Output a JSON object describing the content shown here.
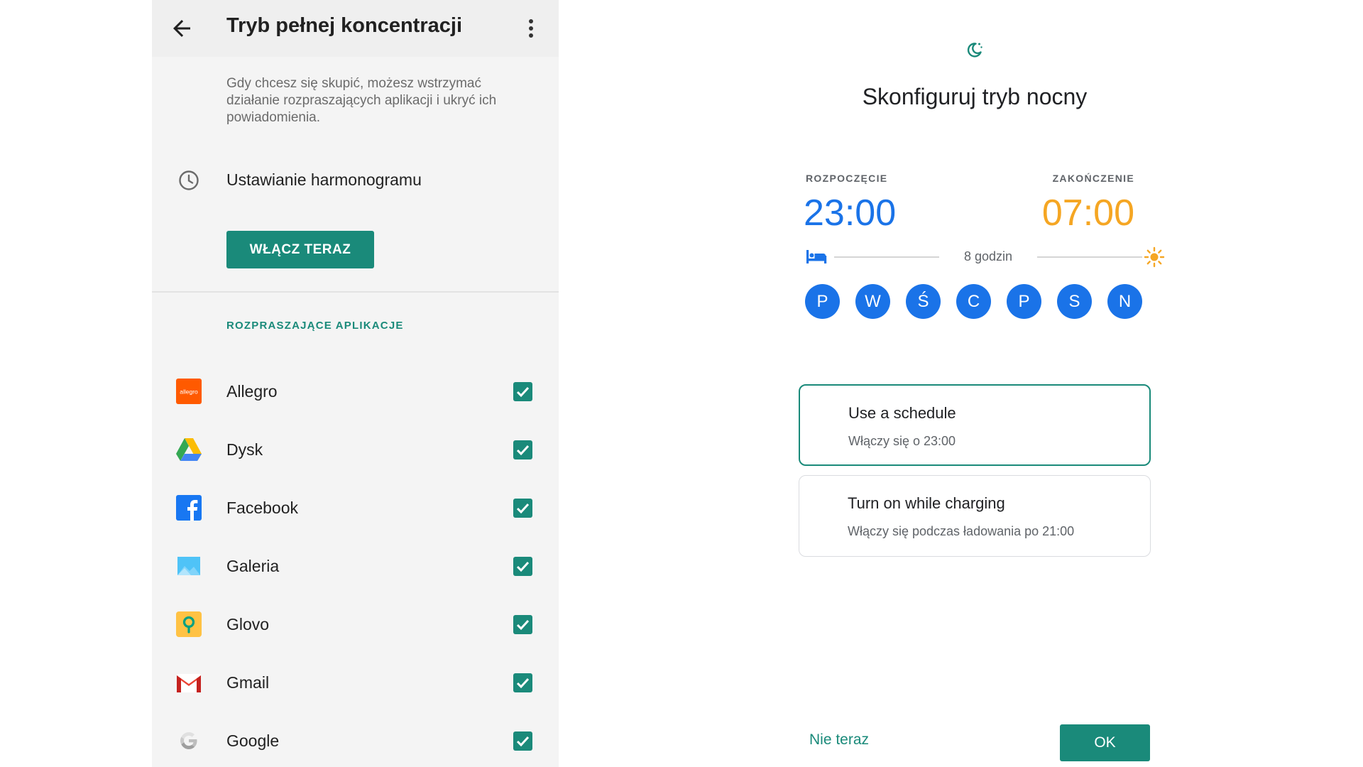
{
  "focus_mode": {
    "title": "Tryb pełnej koncentracji",
    "description": "Gdy chcesz się skupić, możesz wstrzymać działanie rozpraszających aplikacji i ukryć ich powiadomienia.",
    "schedule_label": "Ustawianie harmonogramu",
    "enable_button": "WŁĄCZ TERAZ",
    "section_title": "ROZPRASZAJĄCE APLIKACJE",
    "apps": [
      {
        "name": "Allegro",
        "icon": "allegro-icon",
        "checked": true
      },
      {
        "name": "Dysk",
        "icon": "drive-icon",
        "checked": true
      },
      {
        "name": "Facebook",
        "icon": "facebook-icon",
        "checked": true
      },
      {
        "name": "Galeria",
        "icon": "gallery-icon",
        "checked": true
      },
      {
        "name": "Glovo",
        "icon": "glovo-icon",
        "checked": true
      },
      {
        "name": "Gmail",
        "icon": "gmail-icon",
        "checked": true
      },
      {
        "name": "Google",
        "icon": "google-icon",
        "checked": true
      }
    ]
  },
  "night_mode": {
    "title": "Skonfiguruj tryb nocny",
    "start_label": "ROZPOCZĘCIE",
    "start_time": "23:00",
    "end_label": "ZAKOŃCZENIE",
    "end_time": "07:00",
    "duration": "8 godzin",
    "days": [
      "P",
      "W",
      "Ś",
      "C",
      "P",
      "S",
      "N"
    ],
    "options": [
      {
        "title": "Use a schedule",
        "subtitle": "Włączy się o 23:00",
        "selected": true
      },
      {
        "title": "Turn on while charging",
        "subtitle": "Włączy się podczas ładowania po 21:00",
        "selected": false
      }
    ],
    "not_now_button": "Nie teraz",
    "ok_button": "OK"
  },
  "colors": {
    "teal_accent": "#1a8a7a",
    "blue_accent": "#1a73e8",
    "orange_accent": "#f5a623"
  }
}
